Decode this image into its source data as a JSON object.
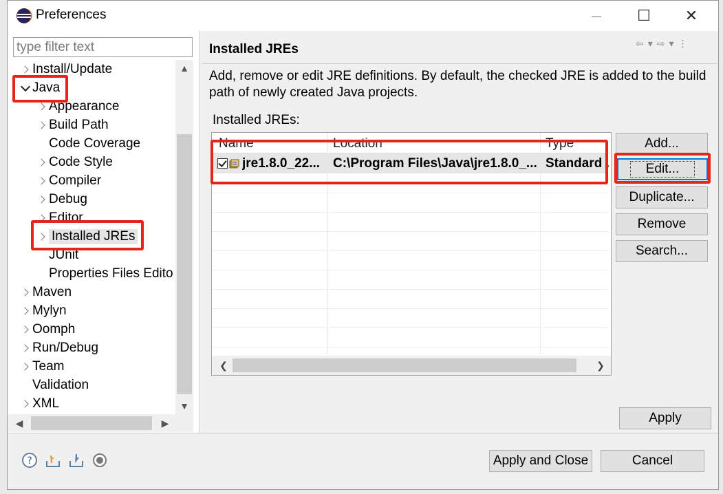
{
  "window": {
    "title": "Preferences",
    "controls": {
      "minimize": "—",
      "maximize": "☐",
      "close": "✕"
    }
  },
  "filter": {
    "placeholder": "type filter text",
    "value": ""
  },
  "tree": {
    "items": [
      {
        "label": "Install/Update",
        "level": 0,
        "expander": "collapsed"
      },
      {
        "label": "Java",
        "level": 0,
        "expander": "expanded"
      },
      {
        "label": "Appearance",
        "level": 1,
        "expander": "collapsed"
      },
      {
        "label": "Build Path",
        "level": 1,
        "expander": "collapsed"
      },
      {
        "label": "Code Coverage",
        "level": 1,
        "expander": "none"
      },
      {
        "label": "Code Style",
        "level": 1,
        "expander": "collapsed"
      },
      {
        "label": "Compiler",
        "level": 1,
        "expander": "collapsed"
      },
      {
        "label": "Debug",
        "level": 1,
        "expander": "collapsed"
      },
      {
        "label": "Editor",
        "level": 1,
        "expander": "collapsed"
      },
      {
        "label": "Installed JREs",
        "level": 1,
        "expander": "collapsed",
        "selected": true
      },
      {
        "label": "JUnit",
        "level": 1,
        "expander": "none"
      },
      {
        "label": "Properties Files Edito",
        "level": 1,
        "expander": "none"
      },
      {
        "label": "Maven",
        "level": 0,
        "expander": "collapsed"
      },
      {
        "label": "Mylyn",
        "level": 0,
        "expander": "collapsed"
      },
      {
        "label": "Oomph",
        "level": 0,
        "expander": "collapsed"
      },
      {
        "label": "Run/Debug",
        "level": 0,
        "expander": "collapsed"
      },
      {
        "label": "Team",
        "level": 0,
        "expander": "collapsed"
      },
      {
        "label": "Validation",
        "level": 0,
        "expander": "none"
      },
      {
        "label": "XML",
        "level": 0,
        "expander": "collapsed"
      }
    ]
  },
  "page": {
    "title": "Installed JREs",
    "description": "Add, remove or edit JRE definitions. By default, the checked JRE is added to the build path of newly created Java projects.",
    "list_label": "Installed JREs:"
  },
  "jre_table": {
    "columns": [
      "Name",
      "Location",
      "Type"
    ],
    "rows": [
      {
        "checked": true,
        "name": "jre1.8.0_22...",
        "location": "C:\\Program Files\\Java\\jre1.8.0_...",
        "type": "Standard ..."
      }
    ]
  },
  "buttons": {
    "add": "Add...",
    "edit": "Edit...",
    "duplicate": "Duplicate...",
    "remove": "Remove",
    "search": "Search...",
    "apply": "Apply",
    "apply_and_close": "Apply and Close",
    "cancel": "Cancel"
  },
  "icons": {
    "help": "help-icon",
    "import": "import-icon",
    "export": "export-icon",
    "oomph": "preference-recorder-icon"
  },
  "colors": {
    "annotation_red": "#e3261b",
    "focus_blue": "#0078d7",
    "selection_gray": "#e6e6e6"
  }
}
